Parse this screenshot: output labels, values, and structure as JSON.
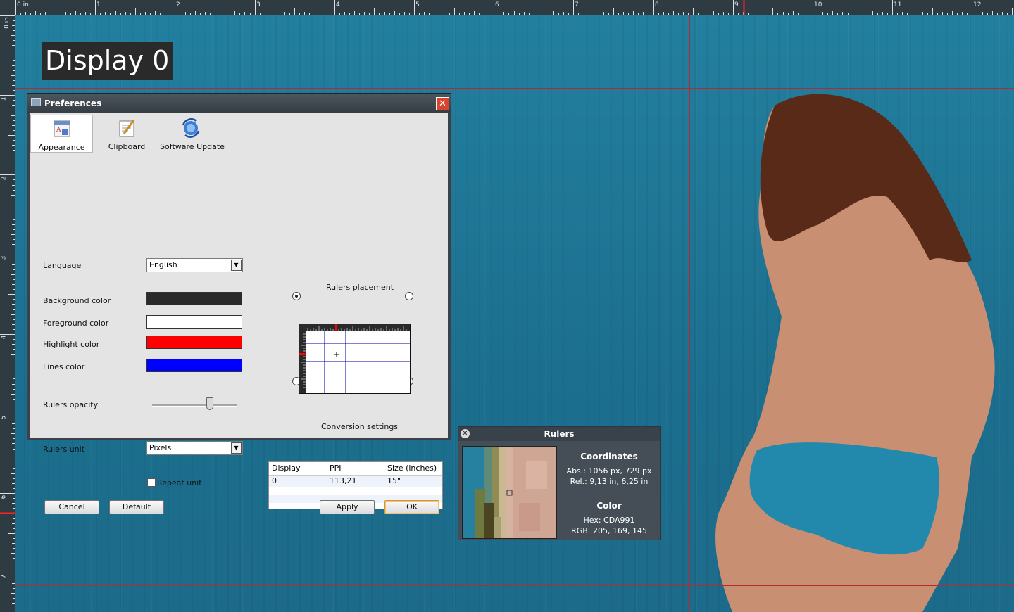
{
  "display": {
    "label": "Display 0"
  },
  "rulers": {
    "top_labels": [
      "0 in",
      "1",
      "2",
      "3",
      "4",
      "5",
      "6",
      "7",
      "8",
      "9",
      "10",
      "11",
      "12"
    ],
    "left_labels": [
      "0 in",
      "1",
      "2",
      "3",
      "4",
      "5",
      "6",
      "7"
    ]
  },
  "preferences": {
    "title": "Preferences",
    "tabs": [
      {
        "label": "Appearance",
        "icon": "appearance-icon"
      },
      {
        "label": "Clipboard",
        "icon": "clipboard-icon"
      },
      {
        "label": "Software Update",
        "icon": "software-update-icon"
      }
    ],
    "language": {
      "label": "Language",
      "value": "English"
    },
    "background_color": {
      "label": "Background color",
      "value": "#2a2a2a"
    },
    "foreground_color": {
      "label": "Foreground color",
      "value": "#ffffff"
    },
    "highlight_color": {
      "label": "Highlight color",
      "value": "#ff0000"
    },
    "lines_color": {
      "label": "Lines color",
      "value": "#0000ff"
    },
    "rulers_opacity": {
      "label": "Rulers opacity",
      "value_fraction": 0.68
    },
    "rulers_unit": {
      "label": "Rulers unit",
      "value": "Pixels"
    },
    "repeat_unit": {
      "label": "Repeat unit",
      "checked": false
    },
    "rulers_placement": {
      "label": "Rulers placement",
      "selected": "top-left"
    },
    "conversion": {
      "label": "Conversion settings",
      "headers": [
        "Display",
        "PPI",
        "Size (inches)"
      ],
      "rows": [
        {
          "display": "0",
          "ppi": "113,21",
          "size": "15\""
        }
      ]
    },
    "buttons": {
      "cancel": "Cancel",
      "default": "Default",
      "apply": "Apply",
      "ok": "OK"
    }
  },
  "rulers_panel": {
    "title": "Rulers",
    "coordinates_title": "Coordinates",
    "abs": "Abs.: 1056 px, 729 px",
    "rel": "Rel.: 9,13 in, 6,25 in",
    "color_title": "Color",
    "hex": "Hex: CDA991",
    "rgb": "RGB: 205, 169, 145",
    "sample_color": "#cda991"
  }
}
